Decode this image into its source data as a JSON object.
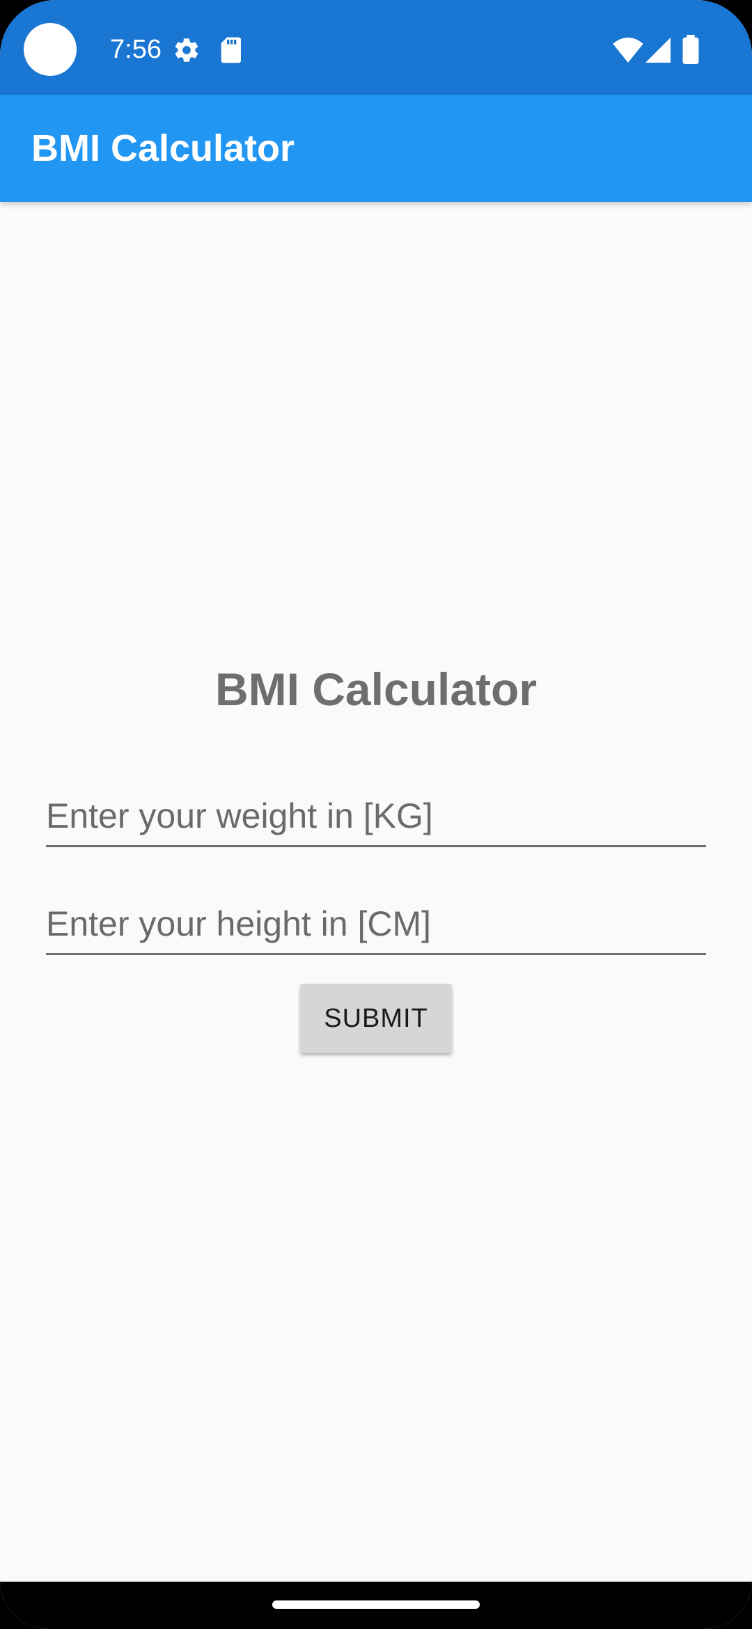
{
  "status_bar": {
    "time": "7:56",
    "icons": [
      "settings-gear-icon",
      "sd-card-icon",
      "wifi-icon",
      "cellular-signal-icon",
      "battery-icon"
    ],
    "background_color": "#1976d2"
  },
  "app_bar": {
    "title": "BMI Calculator",
    "background_color": "#2196f3"
  },
  "form": {
    "heading": "BMI Calculator",
    "weight_field": {
      "placeholder": "Enter your weight in [KG]",
      "value": ""
    },
    "height_field": {
      "placeholder": "Enter your height in [CM]",
      "value": ""
    },
    "submit_label": "SUBMIT"
  },
  "colors": {
    "page_background": "#fafafa",
    "heading_text": "#6e6e6e",
    "button_background": "#d6d6d6"
  }
}
